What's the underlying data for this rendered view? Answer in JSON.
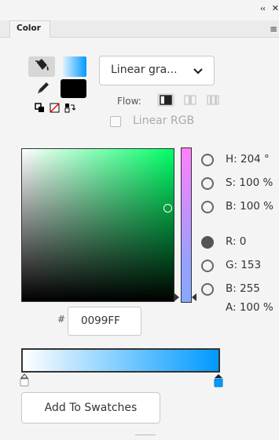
{
  "panel": {
    "tab_label": "Color",
    "collapse_glyph": "‹‹",
    "close_glyph": "✕",
    "menu_icon": "menu-icon"
  },
  "tools": {
    "fill_icon": "paint-bucket-icon",
    "stroke_icon": "pencil-icon",
    "fill_color_gradient": [
      "#ffffff",
      "#0099ff"
    ],
    "stroke_color": "#000000"
  },
  "fill_type": {
    "selected": "Linear gra..."
  },
  "flow": {
    "label": "Flow:"
  },
  "linear_rgb": {
    "label": "Linear RGB",
    "checked": false
  },
  "color_values": {
    "h": "H: 204 °",
    "s": "S: 100 %",
    "b_hsb": "B: 100 %",
    "r": "R: 0",
    "g": "G: 153",
    "b_rgb": "B: 255",
    "a": "A: 100 %",
    "selected_mode": "R"
  },
  "hex": {
    "prefix": "#",
    "value": "0099FF"
  },
  "gradient": {
    "stops": [
      "#ffffff",
      "#0099ff"
    ]
  },
  "add_button": {
    "label": "Add To Swatches"
  }
}
